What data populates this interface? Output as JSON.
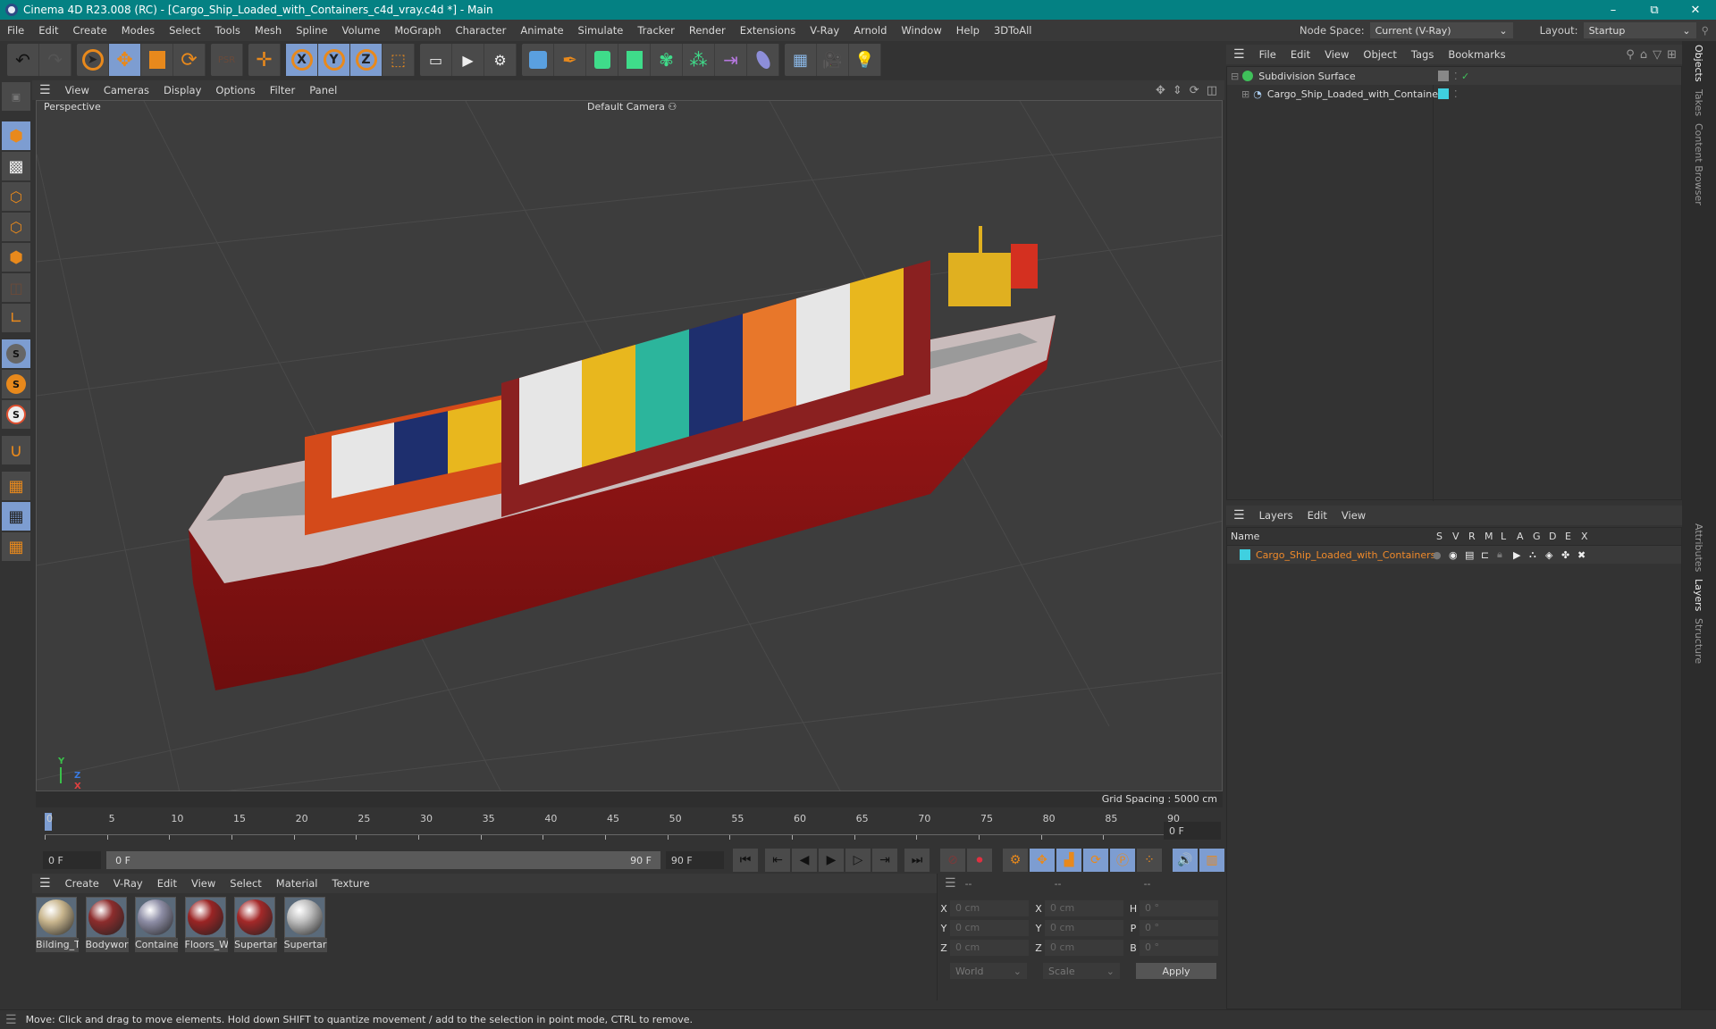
{
  "window": {
    "title": "Cinema 4D R23.008 (RC) - [Cargo_Ship_Loaded_with_Containers_c4d_vray.c4d *] - Main",
    "controls": [
      "–",
      "⧉",
      "✕"
    ]
  },
  "menubar": {
    "items": [
      "File",
      "Edit",
      "Create",
      "Modes",
      "Select",
      "Tools",
      "Mesh",
      "Spline",
      "Volume",
      "MoGraph",
      "Character",
      "Animate",
      "Simulate",
      "Tracker",
      "Render",
      "Extensions",
      "V-Ray",
      "Arnold",
      "Window",
      "Help",
      "3DToAll"
    ],
    "node_space_label": "Node Space:",
    "node_space_value": "Current (V-Ray)",
    "layout_label": "Layout:",
    "layout_value": "Startup"
  },
  "toolbar": {
    "undo": "undo-icon",
    "redo": "redo-icon",
    "axis_x": "X",
    "axis_y": "Y",
    "axis_z": "Z"
  },
  "viewport": {
    "menu": [
      "View",
      "Cameras",
      "Display",
      "Options",
      "Filter",
      "Panel"
    ],
    "view_name": "Perspective",
    "camera": "Default Camera",
    "grid_spacing": "Grid Spacing : 5000 cm",
    "axis_labels": {
      "y": "Y",
      "z": "Z",
      "x": "X"
    }
  },
  "timeline": {
    "ticks": [
      "0",
      "5",
      "10",
      "15",
      "20",
      "25",
      "30",
      "35",
      "40",
      "45",
      "50",
      "55",
      "60",
      "65",
      "70",
      "75",
      "80",
      "85",
      "90"
    ],
    "current_frame": "0 F",
    "start_frame": "0 F",
    "range_start": "0 F",
    "range_end": "90 F",
    "end_frame": "90 F"
  },
  "materials": {
    "menu": [
      "Create",
      "V-Ray",
      "Edit",
      "View",
      "Select",
      "Material",
      "Texture"
    ],
    "items": [
      {
        "name": "Bilding_T",
        "color": "#c9b68e"
      },
      {
        "name": "Bodywor",
        "color": "#8c2c2c"
      },
      {
        "name": "Containe",
        "color": "#8e8ea6"
      },
      {
        "name": "Floors_W",
        "color": "#9a2424"
      },
      {
        "name": "Supertar",
        "color": "#a32828"
      },
      {
        "name": "Supertar",
        "color": "#bdbdbd"
      }
    ]
  },
  "coordinates": {
    "headers": [
      "--",
      "--",
      "--"
    ],
    "rows": [
      {
        "l1": "X",
        "v1": "0 cm",
        "l2": "X",
        "v2": "0 cm",
        "l3": "H",
        "v3": "0 °"
      },
      {
        "l1": "Y",
        "v1": "0 cm",
        "l2": "Y",
        "v2": "0 cm",
        "l3": "P",
        "v3": "0 °"
      },
      {
        "l1": "Z",
        "v1": "0 cm",
        "l2": "Z",
        "v2": "0 cm",
        "l3": "B",
        "v3": "0 °"
      }
    ],
    "space": "World",
    "mode": "Scale",
    "apply": "Apply"
  },
  "objects": {
    "menu": [
      "File",
      "Edit",
      "View",
      "Object",
      "Tags",
      "Bookmarks"
    ],
    "items": [
      {
        "name": "Subdivision Surface",
        "tag_color": "#888888"
      },
      {
        "name": "Cargo_Ship_Loaded_with_Containers",
        "tag_color": "#3fd0e0"
      }
    ]
  },
  "layers": {
    "menu": [
      "Layers",
      "Edit",
      "View"
    ],
    "columns": [
      "Name",
      "S",
      "V",
      "R",
      "M",
      "L",
      "A",
      "G",
      "D",
      "E",
      "X"
    ],
    "items": [
      {
        "name": "Cargo_Ship_Loaded_with_Containers",
        "color": "#3fd0e0"
      }
    ]
  },
  "side_tabs": {
    "top": [
      "Objects",
      "Takes",
      "Content Browser"
    ],
    "bottom": [
      "Attributes",
      "Layers",
      "Structure"
    ]
  },
  "status": "Move: Click and drag to move elements. Hold down SHIFT to quantize movement / add to the selection in point mode, CTRL to remove.",
  "colors": {
    "accent": "#7d9dd1",
    "orange": "#e8891c",
    "title": "#048183",
    "layer_text": "#f08a2a"
  }
}
